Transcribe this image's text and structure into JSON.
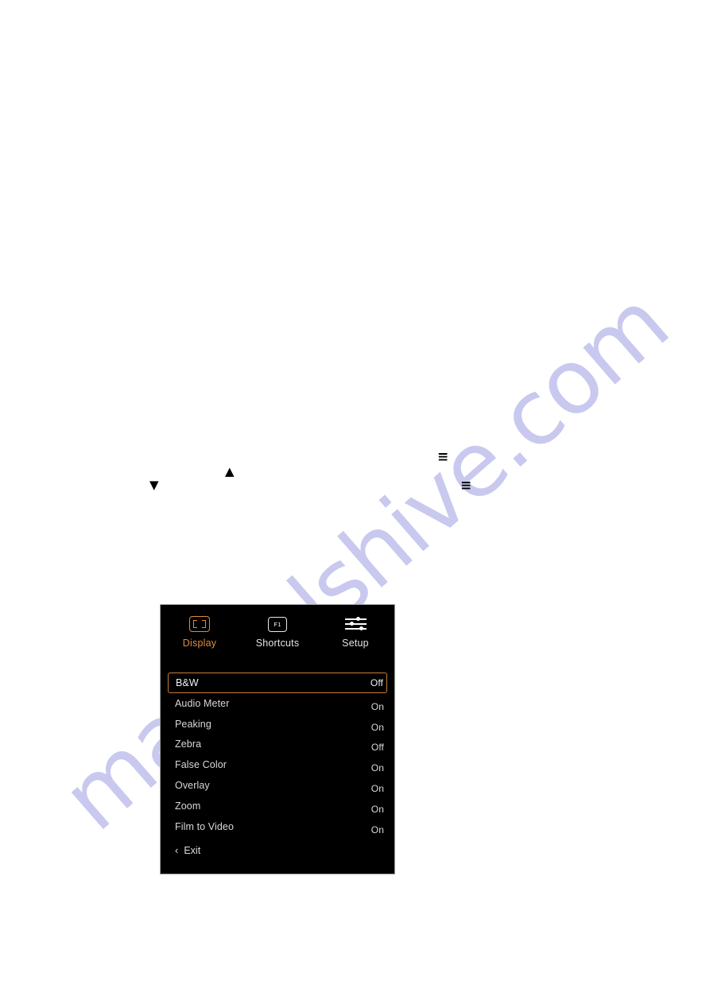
{
  "watermark": {
    "text": "manualshive.com"
  },
  "stray_glyphs": {
    "down_triangle": "▼",
    "up_triangle": "▲",
    "menu_icon_1": "≡",
    "menu_icon_2": "≡"
  },
  "osd": {
    "tabs": [
      {
        "label": "Display",
        "icon": "framing-icon",
        "active": true
      },
      {
        "label": "Shortcuts",
        "icon": "f1-key-icon",
        "active": false
      },
      {
        "label": "Setup",
        "icon": "sliders-icon",
        "active": false
      }
    ],
    "tab_icon_fkey_text": "F1",
    "menu": [
      {
        "label": "B&W",
        "value": "Off",
        "selected": true
      },
      {
        "label": "Audio Meter",
        "value": "On",
        "selected": false
      },
      {
        "label": "Peaking",
        "value": "On",
        "selected": false
      },
      {
        "label": "Zebra",
        "value": "Off",
        "selected": false
      },
      {
        "label": "False Color",
        "value": "On",
        "selected": false
      },
      {
        "label": "Overlay",
        "value": "On",
        "selected": false
      },
      {
        "label": "Zoom",
        "value": "On",
        "selected": false
      },
      {
        "label": "Film to Video",
        "value": "On",
        "selected": false
      }
    ],
    "exit": {
      "chevron": "‹",
      "label": "Exit"
    },
    "colors": {
      "accent": "#e08a3c",
      "selected_border": "#c77e33",
      "panel_background": "#000000",
      "text": "#d8d8d8"
    }
  }
}
